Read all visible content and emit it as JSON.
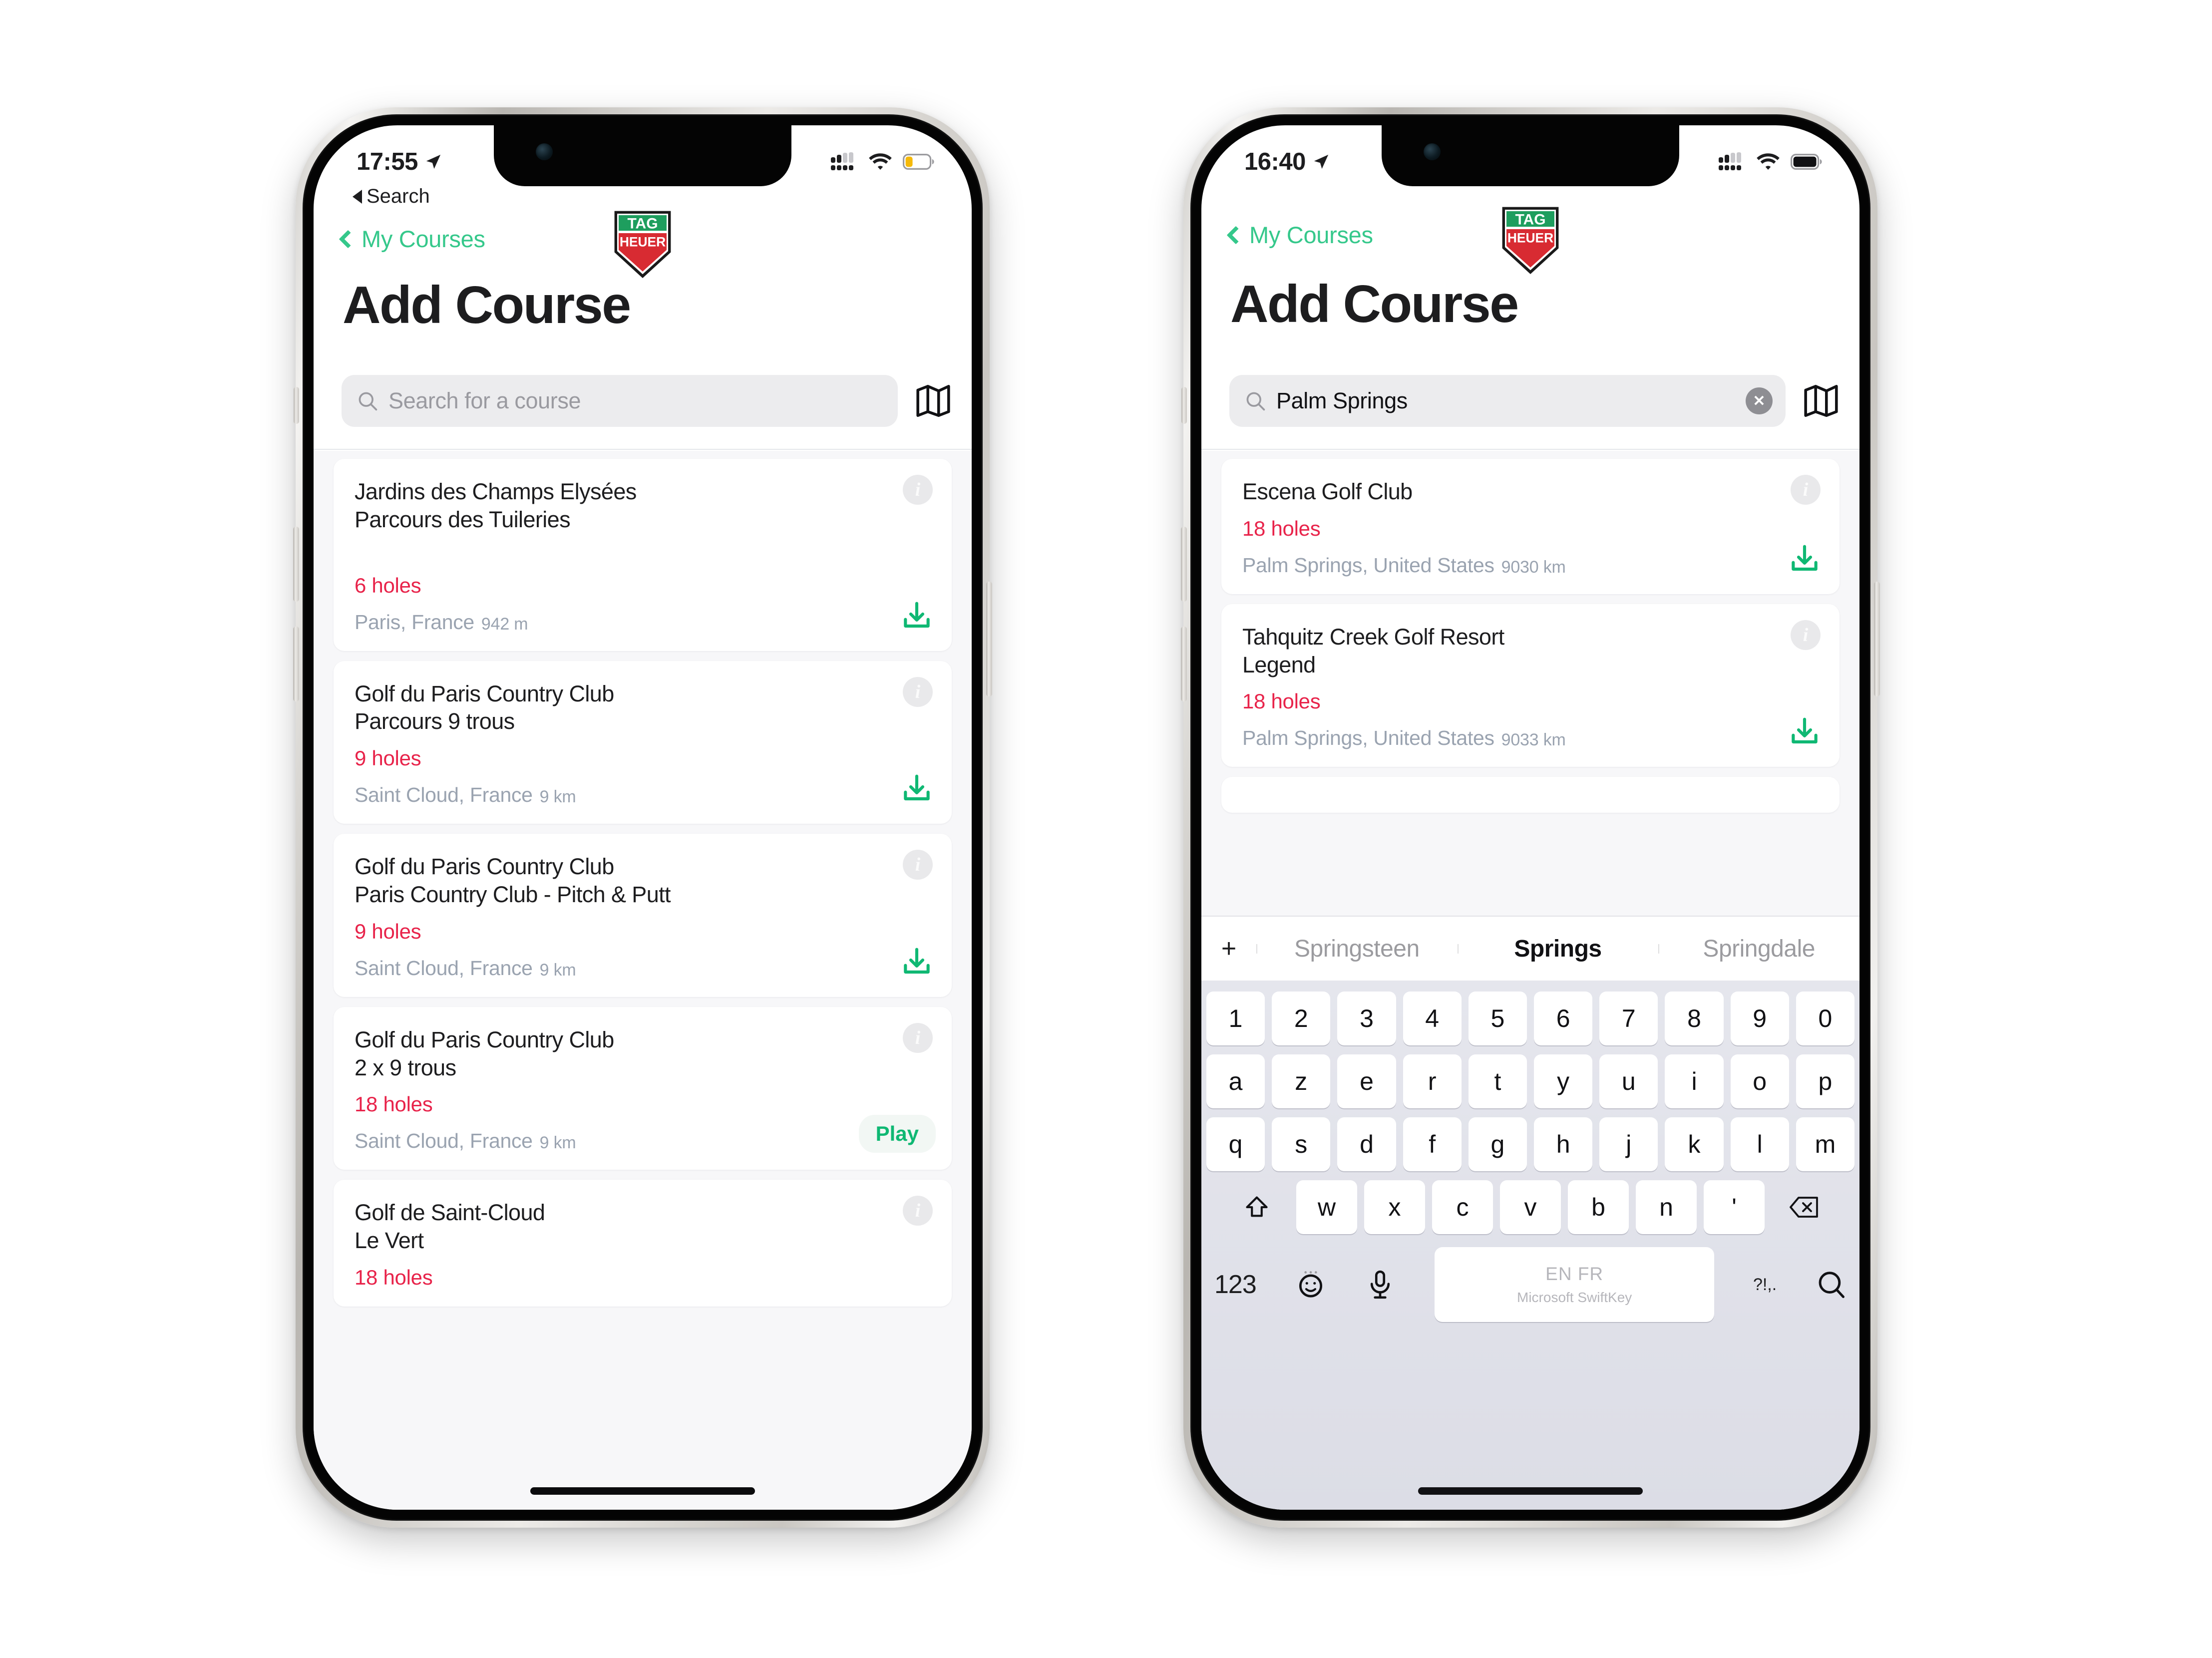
{
  "brand": {
    "logo_text_top": "TAG",
    "logo_text_bottom": "HEUER",
    "green": "#2ea36b",
    "red": "#d82b32"
  },
  "colors": {
    "accent_green": "#35c88b",
    "holes_red": "#e8234a",
    "download_green": "#0fb873",
    "muted": "#9aa3b0"
  },
  "phones": [
    {
      "id": "left",
      "status": {
        "time": "17:55",
        "location_icon": "location-arrow-icon",
        "cellular": "cellular-bars-icon",
        "wifi": "wifi-icon",
        "battery": "battery-low-icon",
        "battery_color": "#f5b90a"
      },
      "prestatus_back": "Search",
      "nav": {
        "back_label": "My Courses"
      },
      "title": "Add Course",
      "search": {
        "value": "",
        "placeholder": "Search for a course",
        "has_clear": false,
        "map_icon": "map-icon"
      },
      "courses": [
        {
          "name": "Jardins des Champs Elysées",
          "sub": "Parcours des Tuileries",
          "holes": "6 holes",
          "location": "Paris, France",
          "distance": "942 m",
          "action": "download",
          "spacer": true
        },
        {
          "name": "Golf du Paris Country Club",
          "sub": "Parcours 9 trous",
          "holes": "9 holes",
          "location": "Saint Cloud, France",
          "distance": "9 km",
          "action": "download",
          "spacer": false
        },
        {
          "name": "Golf du Paris Country Club",
          "sub": "Paris Country Club - Pitch & Putt",
          "holes": "9 holes",
          "location": "Saint Cloud, France",
          "distance": "9 km",
          "action": "download",
          "spacer": false
        },
        {
          "name": "Golf du Paris Country Club",
          "sub": "2 x 9 trous",
          "holes": "18 holes",
          "location": "Saint Cloud, France",
          "distance": "9 km",
          "action": "play",
          "play_label": "Play",
          "spacer": false
        },
        {
          "name": "Golf de Saint-Cloud",
          "sub": "Le Vert",
          "holes": "18 holes",
          "location": "",
          "distance": "",
          "action": "none",
          "spacer": false
        }
      ],
      "keyboard": null
    },
    {
      "id": "right",
      "status": {
        "time": "16:40",
        "location_icon": "location-arrow-icon",
        "cellular": "cellular-bars-icon",
        "wifi": "wifi-icon",
        "battery": "battery-full-icon",
        "battery_color": "#111114"
      },
      "prestatus_back": "",
      "nav": {
        "back_label": "My Courses"
      },
      "title": "Add Course",
      "search": {
        "value": "Palm Springs",
        "placeholder": "Search for a course",
        "has_clear": true,
        "clear_glyph": "✕",
        "map_icon": "map-icon"
      },
      "courses": [
        {
          "name": "Escena Golf Club",
          "sub": "",
          "holes": "18 holes",
          "location": "Palm Springs, United States",
          "distance": "9030 km",
          "action": "download",
          "spacer": false
        },
        {
          "name": "Tahquitz Creek Golf Resort",
          "sub": "Legend",
          "holes": "18 holes",
          "location": "Palm Springs, United States",
          "distance": "9033 km",
          "action": "download",
          "spacer": false
        },
        {
          "name": "",
          "sub": "",
          "holes": "",
          "location": "",
          "distance": "",
          "action": "none",
          "spacer": false
        }
      ],
      "keyboard": {
        "suggestions": {
          "plus": "+",
          "items": [
            {
              "word": "Springsteen",
              "active": false
            },
            {
              "word": "Springs",
              "active": true
            },
            {
              "word": "Springdale",
              "active": false
            }
          ]
        },
        "rows": [
          [
            "1",
            "2",
            "3",
            "4",
            "5",
            "6",
            "7",
            "8",
            "9",
            "0"
          ],
          [
            "a",
            "z",
            "e",
            "r",
            "t",
            "y",
            "u",
            "i",
            "o",
            "p"
          ],
          [
            "q",
            "s",
            "d",
            "f",
            "g",
            "h",
            "j",
            "k",
            "l",
            "m"
          ],
          [
            "w",
            "x",
            "c",
            "v",
            "b",
            "n",
            "'"
          ]
        ],
        "shift_icon": "shift-up-arrow-icon",
        "backspace_icon": "backspace-delete-icon",
        "numeric_label": "123",
        "emoji_icon": "emoji-smiley-icon",
        "mic_icon": "microphone-icon",
        "space": {
          "lang": "EN FR",
          "brand": "Microsoft SwiftKey"
        },
        "punct_label": "?!,.",
        "search_key_icon": "search-magnifier-icon"
      }
    }
  ]
}
